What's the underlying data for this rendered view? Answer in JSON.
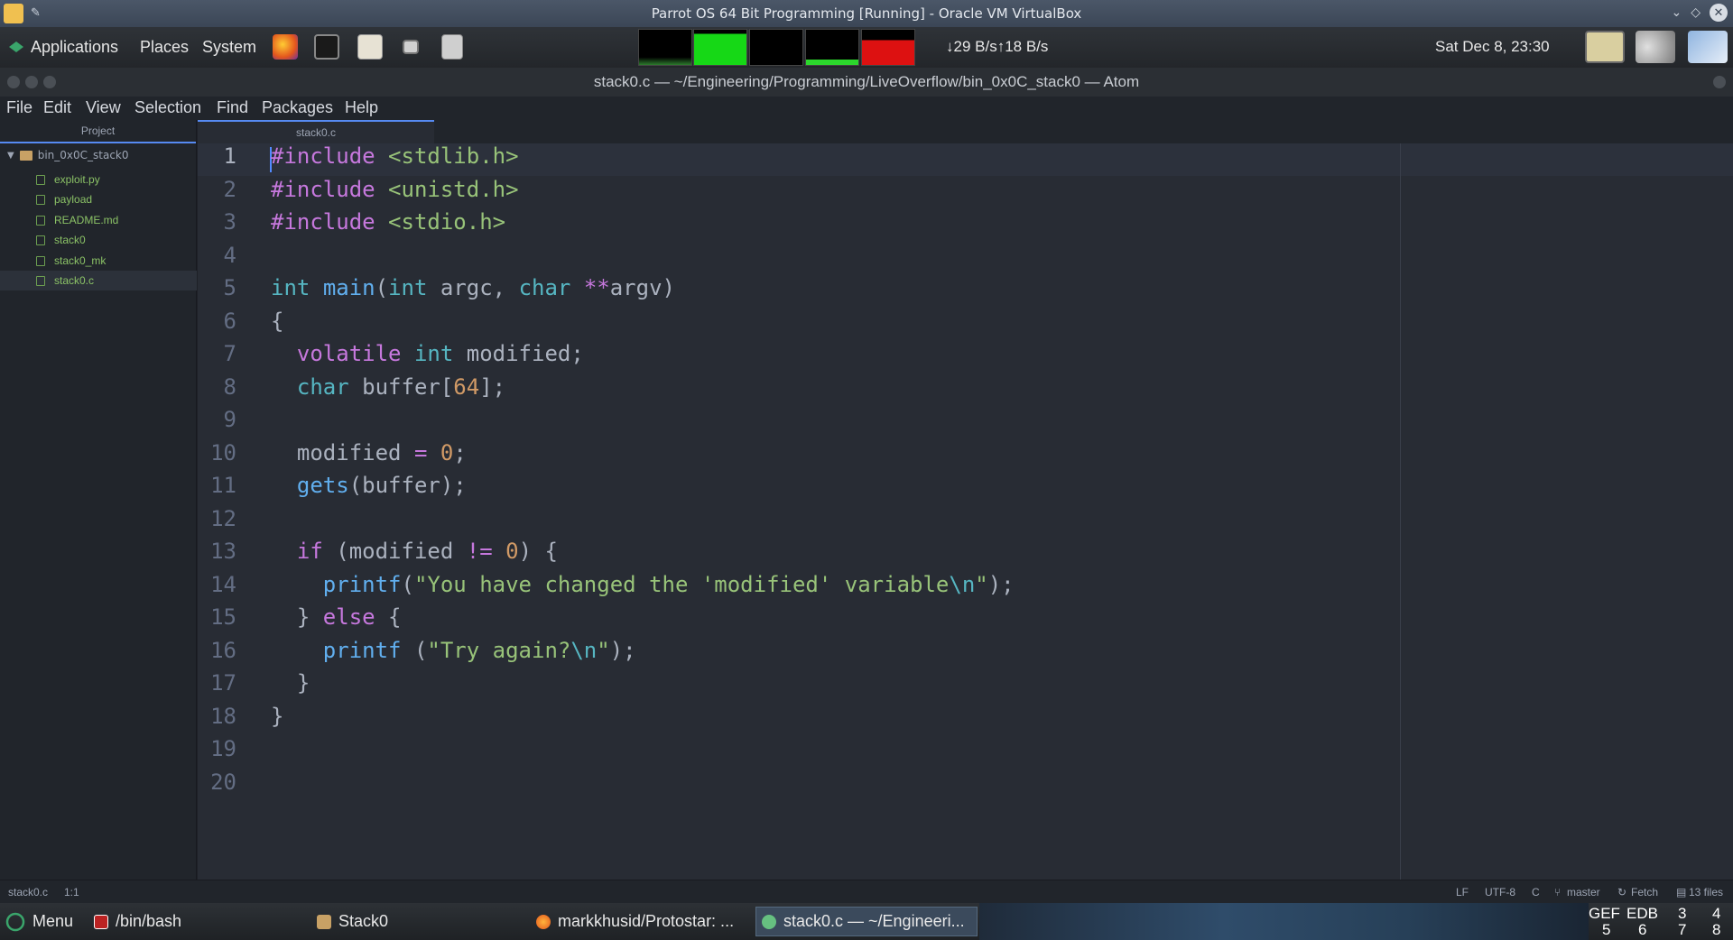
{
  "vbox": {
    "title": "Parrot OS 64 Bit Programming [Running] - Oracle VM VirtualBox",
    "controls": [
      "⌄",
      "◇",
      "✕"
    ]
  },
  "top_panel": {
    "menus": [
      "Applications",
      "Places",
      "System"
    ],
    "network": "↓29 B/s↑18 B/s",
    "clock": "Sat Dec 8, 23:30"
  },
  "atom": {
    "title": "stack0.c — ~/Engineering/Programming/LiveOverflow/bin_0x0C_stack0 — Atom",
    "menu": [
      "File",
      "Edit",
      "View",
      "Selection",
      "Find",
      "Packages",
      "Help"
    ],
    "tree": {
      "panel_title": "Project",
      "root": "bin_0x0C_stack0",
      "files": [
        "exploit.py",
        "payload",
        "README.md",
        "stack0",
        "stack0_mk",
        "stack0.c"
      ],
      "selected": "stack0.c"
    },
    "tab": "stack0.c",
    "line_numbers": [
      "1",
      "2",
      "3",
      "4",
      "5",
      "6",
      "7",
      "8",
      "9",
      "10",
      "11",
      "12",
      "13",
      "14",
      "15",
      "16",
      "17",
      "18",
      "19",
      "20"
    ],
    "code": [
      "#include <stdlib.h>",
      "#include <unistd.h>",
      "#include <stdio.h>",
      "",
      "int main(int argc, char **argv)",
      "{",
      "  volatile int modified;",
      "  char buffer[64];",
      "",
      "  modified = 0;",
      "  gets(buffer);",
      "",
      "  if (modified != 0) {",
      "    printf(\"You have changed the 'modified' variable\\n\");",
      "  } else {",
      "    printf (\"Try again?\\n\");",
      "  }",
      "}",
      "",
      ""
    ],
    "status": {
      "file": "stack0.c",
      "cursor": "1:1",
      "eol": "LF",
      "encoding": "UTF-8",
      "grammar": "C",
      "branch": "master",
      "fetch": "Fetch",
      "files": "13 files"
    }
  },
  "bottom_panel": {
    "menu": "Menu",
    "tasks": [
      "/bin/bash",
      "Stack0",
      "markkhusid/Protostar: ...",
      "stack0.c — ~/Engineeri..."
    ],
    "workspaces": [
      "GEF",
      "EDB",
      "3",
      "4",
      "5",
      "6",
      "7",
      "8"
    ]
  }
}
